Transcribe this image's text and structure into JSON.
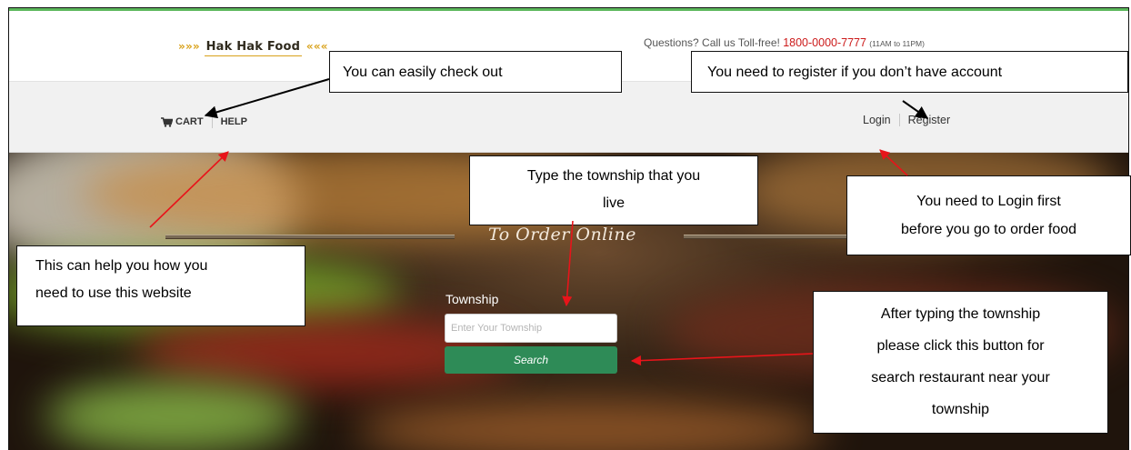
{
  "header": {
    "logo_text": "Hak Hak Food",
    "logo_deco_left": "»»»",
    "logo_deco_right": "«««",
    "contact_prefix": "Questions? Call us Toll-free!",
    "phone": "1800-0000-7777",
    "hours": "(11AM to 11PM)"
  },
  "nav": {
    "cart_label": "CART",
    "help_label": "HELP",
    "login_label": "Login",
    "register_label": "Register"
  },
  "hero": {
    "title": "To Order Online",
    "township_label": "Township",
    "township_placeholder": "Enter Your Township",
    "township_value": "",
    "search_label": "Search"
  },
  "annotations": {
    "checkout": "You can easily check out",
    "register": "You need to register if you don’t have account",
    "township_line1": "Type the township that you",
    "township_line2": "live",
    "login_line1": "You need to Login first",
    "login_line2": "before you go to order food",
    "help_line1": "This can help you how you",
    "help_line2": "need to use this website",
    "search_line1": "After typing the township",
    "search_line2": "please click this button for",
    "search_line3": "search restaurant near your",
    "search_line4": "township"
  },
  "colors": {
    "accent_green": "#2e8b57",
    "top_line": "#5cb85c",
    "phone_red": "#cc1a1a",
    "logo_gold": "#d9a21b",
    "arrow_red": "#e8141a"
  }
}
